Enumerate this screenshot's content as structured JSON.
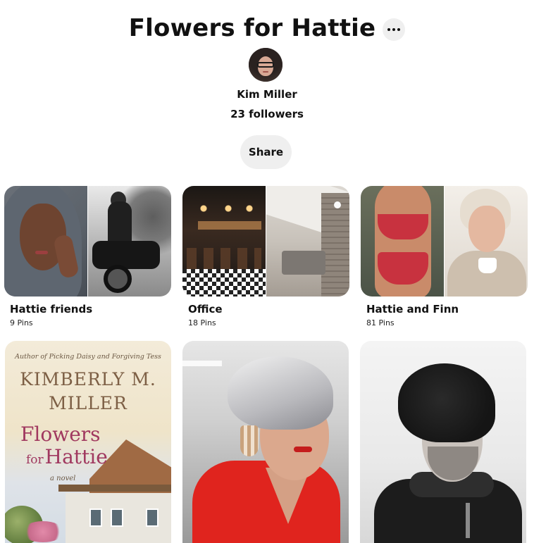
{
  "board": {
    "title": "Flowers for Hattie",
    "owner": "Kim Miller",
    "followers": "23 followers",
    "share_label": "Share"
  },
  "sections": [
    {
      "name": "Hattie friends",
      "count": "9 Pins"
    },
    {
      "name": "Office",
      "count": "18 Pins"
    },
    {
      "name": "Hattie and Finn",
      "count": "81 Pins"
    }
  ],
  "pins": {
    "book": {
      "author_line": "Author of Picking Daisy and Forgiving Tess",
      "author_first": "KIMBERLY M.",
      "author_last": "MILLER",
      "title_line1": "Flowers",
      "title_for": "for",
      "title_line2": "Hattie",
      "subtitle": "a novel"
    }
  },
  "icons": {
    "more": "ellipsis-icon"
  },
  "colors": {
    "button_bg": "#efefef",
    "text": "#111111",
    "dress_red": "#e0241e",
    "book_title": "#a0385f"
  }
}
